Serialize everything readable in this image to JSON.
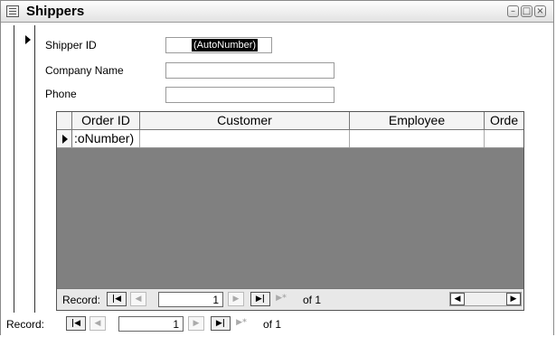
{
  "window": {
    "title": "Shippers",
    "minimize_glyph": "–",
    "restore_glyph": "□",
    "close_glyph": "×"
  },
  "form": {
    "fields": [
      {
        "label": "Shipper ID",
        "value": "(AutoNumber)"
      },
      {
        "label": "Company Name",
        "value": ""
      },
      {
        "label": "Phone",
        "value": ""
      }
    ]
  },
  "subform": {
    "columns": [
      "Order ID",
      "Customer",
      "Employee",
      "Orde"
    ],
    "row": {
      "order_id": ":oNumber)",
      "customer": "",
      "employee": "",
      "order": ""
    },
    "nav": {
      "label": "Record:",
      "current": "1",
      "of_text": "of 1"
    }
  },
  "main_nav": {
    "label": "Record:",
    "current": "1",
    "of_text": "of 1"
  },
  "icons": {
    "first": "first-record-icon",
    "prev": "previous-record-icon",
    "next": "next-record-icon",
    "last": "last-record-icon",
    "new": "new-record-icon"
  }
}
